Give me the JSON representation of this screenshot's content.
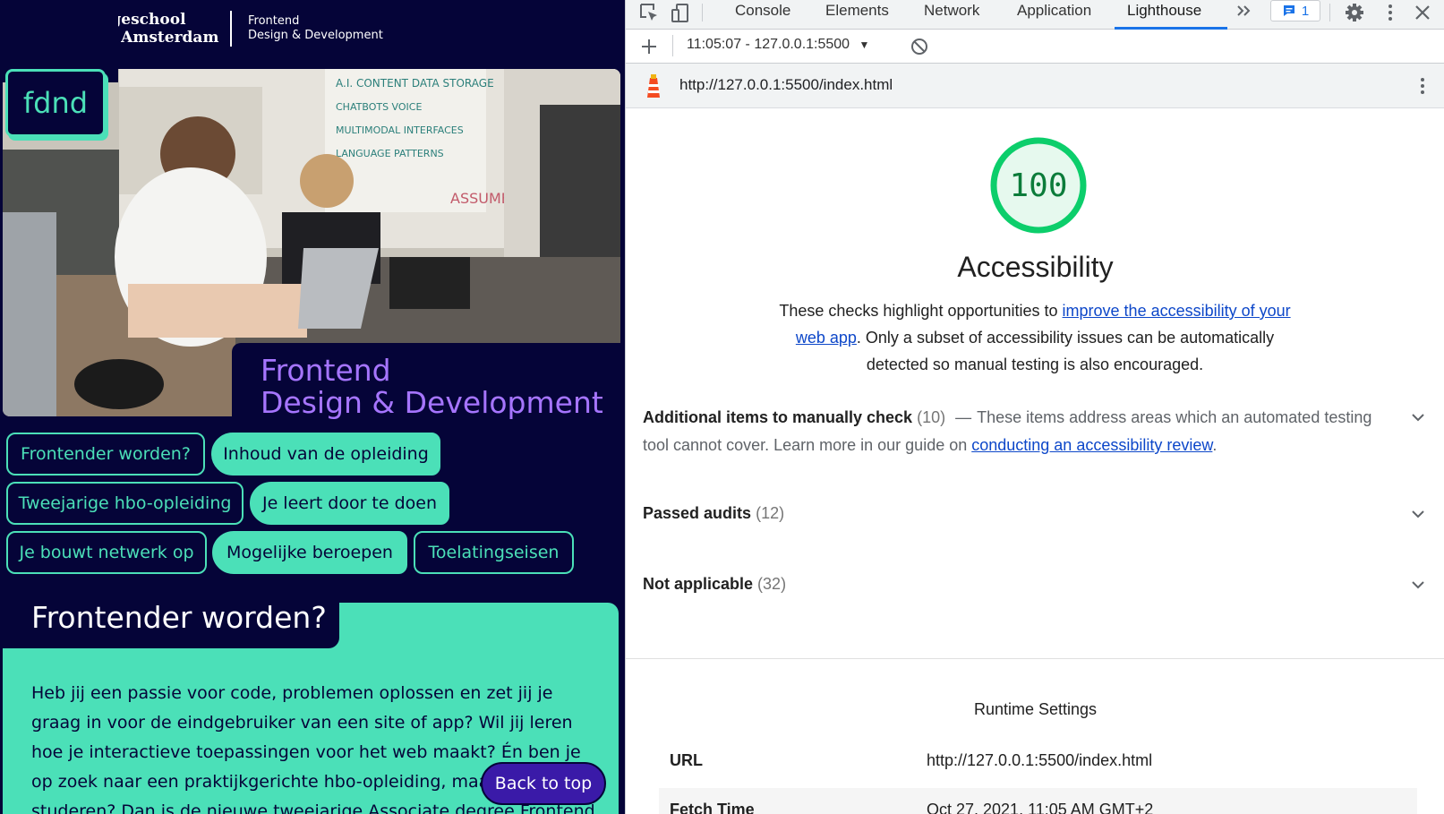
{
  "website": {
    "brand": {
      "school_line1": "Hogeschool",
      "school_line2": "van Amsterdam",
      "program_line1": "Frontend",
      "program_line2": "Design & Development",
      "fdnd_logo": "fdnd"
    },
    "hero": {
      "title_line1": "Frontend",
      "title_line2": "Design & Development"
    },
    "nav_pills": [
      {
        "label": "Frontender worden?",
        "filled": false
      },
      {
        "label": "Inhoud van de opleiding",
        "filled": true
      },
      {
        "label": "Tweejarige hbo-opleiding",
        "filled": false
      },
      {
        "label": "Je leert door te doen",
        "filled": true
      },
      {
        "label": "Je bouwt netwerk op",
        "filled": false
      },
      {
        "label": "Mogelijke beroepen",
        "filled": true
      },
      {
        "label": "Toelatingseisen",
        "filled": false
      }
    ],
    "section": {
      "heading": "Frontender worden?",
      "body": "Heb jij een passie voor code, problemen oplossen en zet jij je graag in voor de eindgebruiker van een site of app? Wil jij leren hoe je interactieve toepassingen voor het web maakt? Én ben je op zoek naar een praktijkgerichte hbo-opleiding, maar wil je niet studeren? Dan is de nieuwe tweejarige Associate degree Frontend"
    },
    "back_to_top": "Back to top",
    "colors": {
      "navy": "#050438",
      "mint": "#4be0b8",
      "purple": "#a675ff"
    }
  },
  "devtools": {
    "tabs": [
      "Console",
      "Elements",
      "Network",
      "Application",
      "Lighthouse"
    ],
    "active_tab": "Lighthouse",
    "more_tabs_icon": "double-chevron-icon",
    "issues_count": "1",
    "report_selector": "11:05:07 - 127.0.0.1:5500",
    "report_url": "http://127.0.0.1:5500/index.html",
    "score": "100",
    "category_title": "Accessibility",
    "description": {
      "before": "These checks highlight opportunities to ",
      "link": "improve the accessibility of your web app",
      "after": ". Only a subset of accessibility issues can be automatically detected so manual testing is also encouraged."
    },
    "manual_check": {
      "title": "Additional items to manually check",
      "count": "(10)",
      "dash": "—",
      "desc": "These items address areas which an automated testing tool cannot cover. Learn more in our guide on ",
      "link": "conducting an accessibility review",
      "end": "."
    },
    "passed": {
      "title": "Passed audits",
      "count": "(12)"
    },
    "not_applicable": {
      "title": "Not applicable",
      "count": "(32)"
    },
    "runtime": {
      "title": "Runtime Settings",
      "url_label": "URL",
      "url_value": "http://127.0.0.1:5500/index.html",
      "fetch_label": "Fetch Time",
      "fetch_value": "Oct 27, 2021, 11:05 AM GMT+2"
    },
    "colors": {
      "pass": "#0cce6b",
      "pass_text": "#0c7c3a",
      "link": "#0d47c9",
      "accent": "#1a73e8"
    }
  }
}
